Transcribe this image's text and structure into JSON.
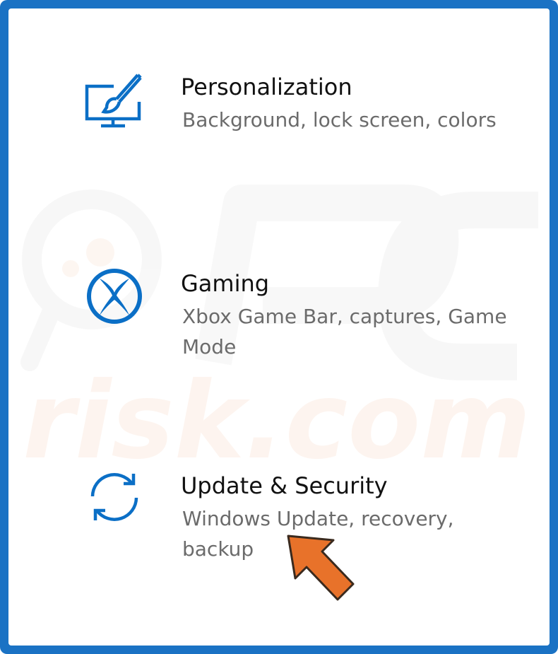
{
  "accent_color": "#1a72c4",
  "items": [
    {
      "icon": "personalization-icon",
      "title": "Personalization",
      "description": "Background, lock screen, colors"
    },
    {
      "icon": "xbox-icon",
      "title": "Gaming",
      "description": "Xbox Game Bar, captures, Game Mode"
    },
    {
      "icon": "sync-icon",
      "title": "Update & Security",
      "description": "Windows Update, recovery, backup"
    }
  ],
  "pointer": {
    "icon": "orange-arrow-icon",
    "color": "#e8722a"
  },
  "watermark": {
    "text": "PC risk.com"
  }
}
